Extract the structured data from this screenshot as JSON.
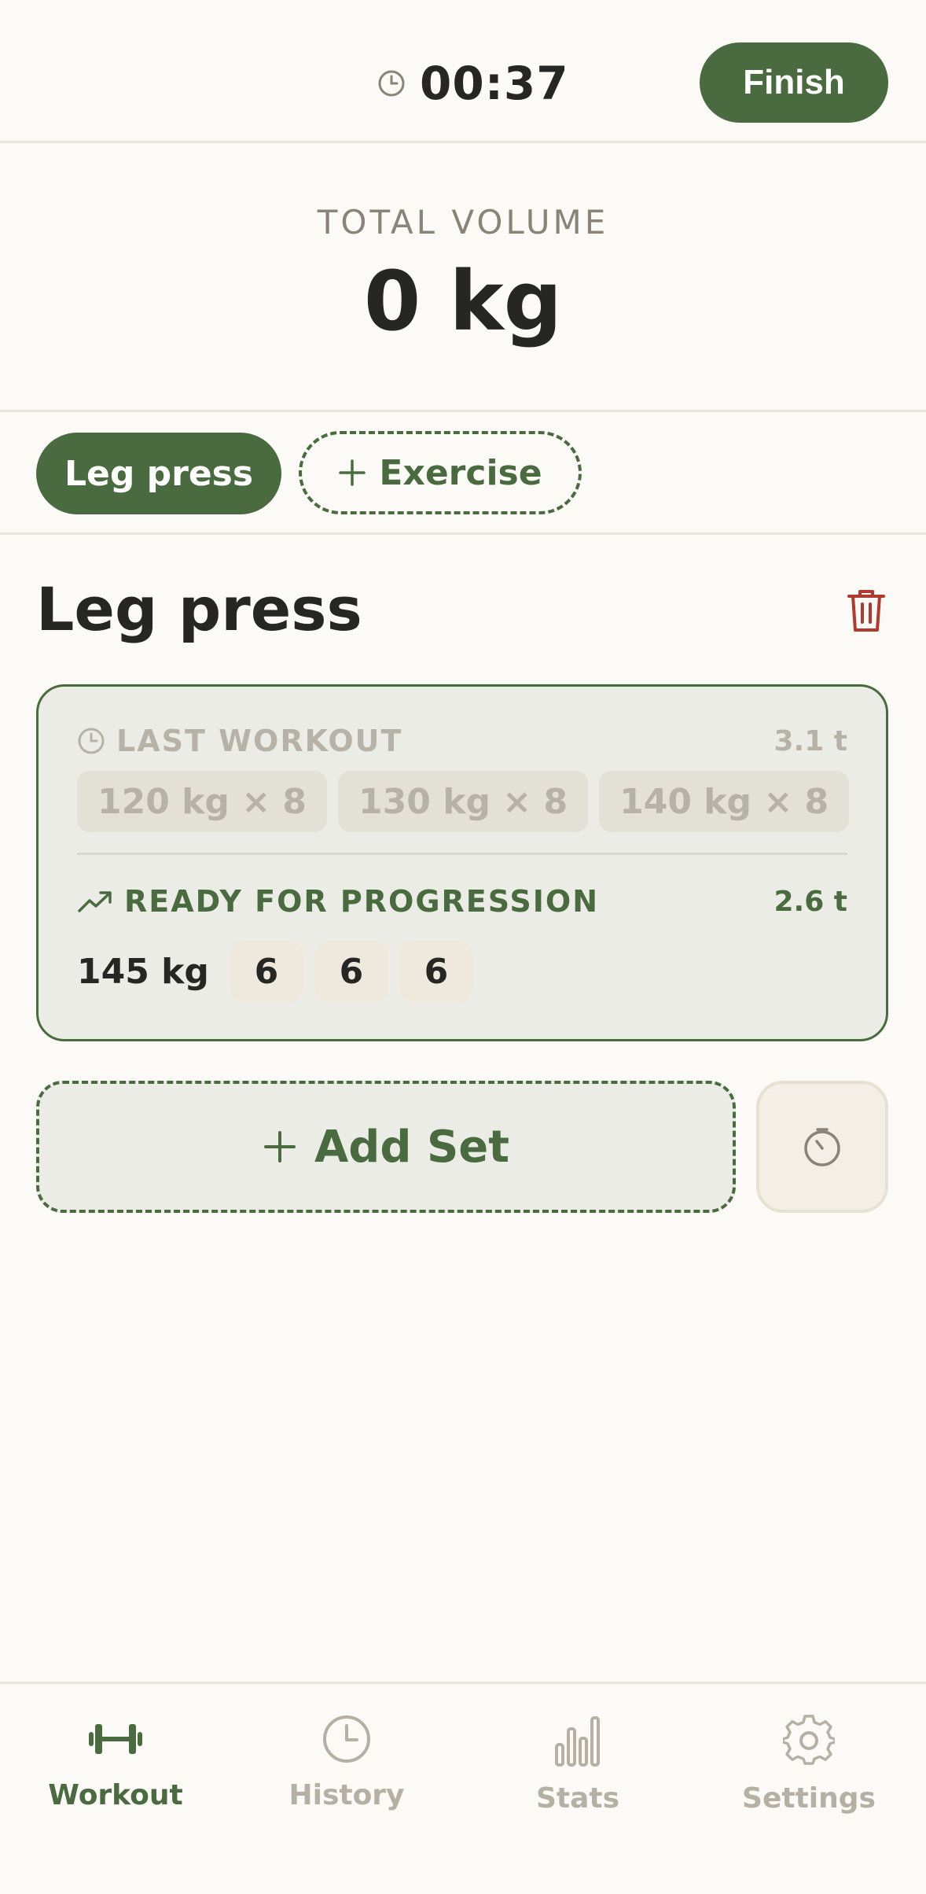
{
  "header": {
    "timer": "00:37",
    "timer_icon": "clock-icon",
    "finish_label": "Finish"
  },
  "volume": {
    "label": "TOTAL VOLUME",
    "value": "0 kg"
  },
  "tabs": {
    "items": [
      {
        "label": "Leg press",
        "active": true
      }
    ],
    "add_label": "Exercise"
  },
  "exercise": {
    "title": "Leg press",
    "delete_icon": "trash-icon",
    "last_workout": {
      "label": "LAST WORKOUT",
      "total": "3.1 t",
      "sets": [
        "120 kg × 8",
        "130 kg × 8",
        "140 kg × 8"
      ]
    },
    "progression": {
      "label": "READY FOR PROGRESSION",
      "total": "2.6 t",
      "weight": "145 kg",
      "reps": [
        "6",
        "6",
        "6"
      ]
    },
    "add_set_label": "Add Set",
    "rest_timer_icon": "stopwatch-icon"
  },
  "nav": {
    "items": [
      {
        "label": "Workout",
        "icon": "dumbbell-icon",
        "active": true
      },
      {
        "label": "History",
        "icon": "clock-icon",
        "active": false
      },
      {
        "label": "Stats",
        "icon": "bar-chart-icon",
        "active": false
      },
      {
        "label": "Settings",
        "icon": "gear-icon",
        "active": false
      }
    ]
  },
  "colors": {
    "accent": "#4a6b3f",
    "background": "#fbfaf6",
    "danger": "#b03a2e",
    "muted": "#b7b2a8"
  }
}
